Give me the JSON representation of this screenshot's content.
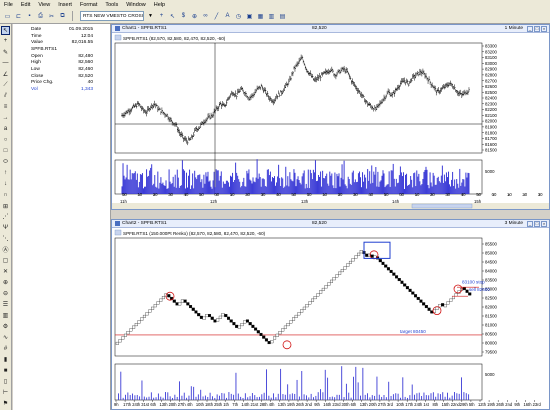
{
  "menu": [
    "File",
    "Edit",
    "View",
    "Insert",
    "Format",
    "Tools",
    "Window",
    "Help"
  ],
  "toolbar": {
    "instrument": "RTS NEW VMESTO CROSI",
    "left_icons": [
      "new-icon",
      "open-icon",
      "save-icon",
      "print-icon",
      "cut-icon",
      "copy-icon"
    ],
    "right_icons": [
      "crosshair-icon",
      "cursor-icon",
      "dollar-icon",
      "zoom-icon",
      "binoculars-icon",
      "line-tool-icon",
      "text-tool-icon",
      "period-icon",
      "window-icon",
      "grid-icon",
      "tile-icon",
      "cascade-icon"
    ]
  },
  "left_tools": [
    "cursor-icon",
    "crosshair-icon",
    "pencil-icon",
    "line-icon",
    "angle-icon",
    "trend-icon",
    "channel-icon",
    "fib-icon",
    "ray-icon",
    "text-abc-icon",
    "circle-icon",
    "rect-icon",
    "ellipse-icon",
    "arrow-up-icon",
    "arrow-down-icon",
    "cycle-icon",
    "gann-icon",
    "fan-icon",
    "pitchfork-icon",
    "speed-icon",
    "abc-icon",
    "box-icon",
    "delete-icon",
    "zoom-in-icon",
    "zoom-out-icon",
    "list-icon",
    "tile-icon",
    "settings-icon",
    "wave-icon",
    "hash-icon",
    "bar-icon",
    "stop-icon",
    "doc-icon",
    "ruler-icon",
    "flag-icon"
  ],
  "info": {
    "rows": [
      {
        "label": "Date",
        "value": "01.09.2015"
      },
      {
        "label": "Time",
        "value": "12:04"
      },
      {
        "label": "Value",
        "value": "82,016.55"
      }
    ],
    "symbol": "SPFB.RTS1",
    "quotes": [
      {
        "label": "Open",
        "value": "82,480"
      },
      {
        "label": "High",
        "value": "82,560"
      },
      {
        "label": "Low",
        "value": "82,460"
      },
      {
        "label": "Close",
        "value": "82,520"
      },
      {
        "label": "Price Chg.",
        "value": "40"
      }
    ],
    "vol": {
      "label": "Vol",
      "value": "1,343"
    }
  },
  "chart1": {
    "title": "Chart1 - SPFB.RTS1",
    "price": "82,520",
    "timeframe": "1 Minute",
    "legend": "SPFB.RTS1 (82,570, 82,580, 82,470, 82,520, -60)",
    "y_ticks": [
      "83300",
      "83200",
      "83100",
      "83000",
      "82900",
      "82800",
      "82700",
      "82600",
      "82500",
      "82400",
      "82300",
      "82200",
      "82100",
      "82000",
      "81900",
      "81800",
      "81700",
      "81600",
      "81500"
    ],
    "vol_tick": "5000",
    "x_ticks": [
      "00",
      "10",
      "20",
      "30",
      "40",
      "50",
      "00",
      "10",
      "20",
      "30",
      "40",
      "50",
      "00",
      "10",
      "20",
      "30",
      "40",
      "50",
      "00",
      "10",
      "20",
      "30",
      "40",
      "50",
      "00",
      "10",
      "20",
      "30"
    ],
    "hour_labels": [
      "11h",
      "12h",
      "13h",
      "14h",
      "15h"
    ],
    "hline_price": 81950
  },
  "chart2": {
    "title": "Chart2 - SPFB.RTS1",
    "price": "82,520",
    "timeframe": "3 Minute",
    "legend": "SPFB.RTS1 (150.000Pt Renko) (82,570, 82,580, 82,470, 82,520, -60)",
    "y_ticks": [
      "85500",
      "85000",
      "84500",
      "84000",
      "83500",
      "83000",
      "82500",
      "82000",
      "81500",
      "81000",
      "80500",
      "80000",
      "79500"
    ],
    "vol_tick": "5000",
    "x_ticks": [
      "9h",
      "17th",
      "24th",
      "31st",
      "6th",
      "13th",
      "20th",
      "27th",
      "4th",
      "10th",
      "18th",
      "25th",
      "1th",
      "7th",
      "14th",
      "21st",
      "28th",
      "4th",
      "13th",
      "19th",
      "26th",
      "2nd",
      "9th",
      "16th",
      "23rd",
      "30th",
      "6th",
      "13th",
      "20th",
      "27th",
      "3rd",
      "10th",
      "17th",
      "24th",
      "1st",
      "8th",
      "15th",
      "22nd",
      "29th",
      "5th",
      "12th",
      "19th",
      "26th",
      "2nd",
      "9th",
      "16th",
      "23rd"
    ],
    "annotations": {
      "stop": "83100 stop",
      "sell": "sell 82600",
      "target": "target 80450"
    },
    "target_price": 80450
  }
}
